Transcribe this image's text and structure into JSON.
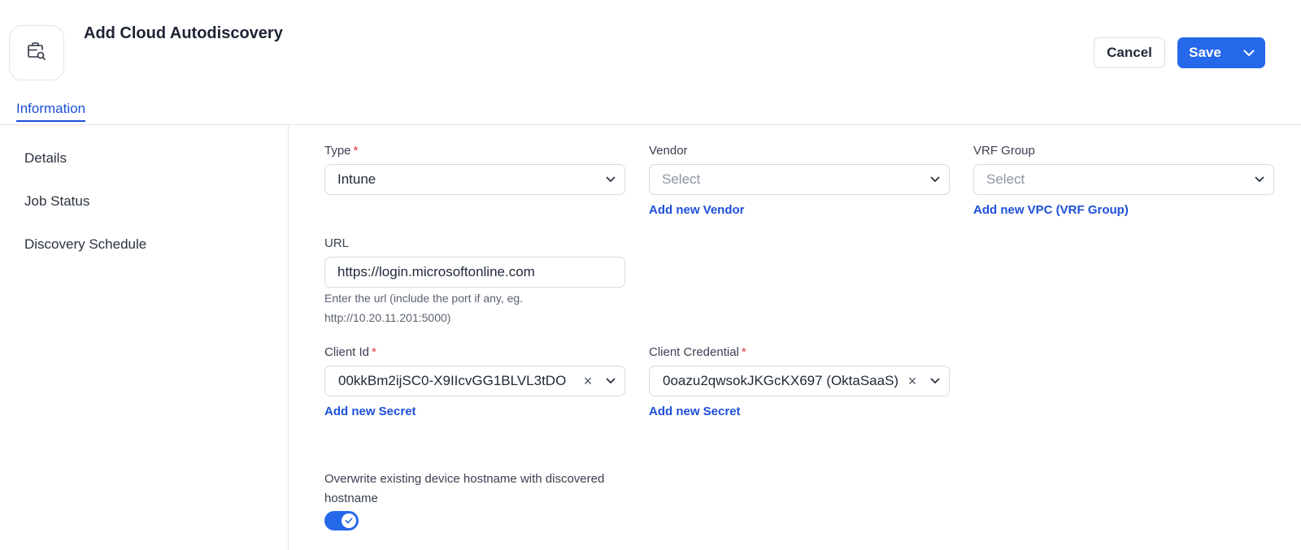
{
  "header": {
    "title": "Add Cloud Autodiscovery",
    "icon": "briefcase-search-icon",
    "cancel_label": "Cancel",
    "save_label": "Save"
  },
  "tabs": [
    {
      "label": "Information",
      "active": true
    }
  ],
  "sidebar": {
    "items": [
      {
        "label": "Details"
      },
      {
        "label": "Job Status"
      },
      {
        "label": "Discovery Schedule"
      }
    ]
  },
  "form": {
    "type": {
      "label": "Type",
      "required": "*",
      "value": "Intune"
    },
    "vendor": {
      "label": "Vendor",
      "placeholder": "Select",
      "add_link": "Add new Vendor"
    },
    "vrf_group": {
      "label": "VRF Group",
      "placeholder": "Select",
      "add_link": "Add new VPC (VRF Group)"
    },
    "url": {
      "label": "URL",
      "value": "https://login.microsoftonline.com",
      "hint_line1": "Enter the url (include the port if any, eg.",
      "hint_line2": "http://10.20.11.201:5000)"
    },
    "client_id": {
      "label": "Client Id",
      "required": "*",
      "value": "00kkBm2ijSC0-X9IIcvGG1BLVL3tDO",
      "add_link": "Add new Secret"
    },
    "client_credential": {
      "label": "Client Credential",
      "required": "*",
      "value": "0oazu2qwsokJKGcKX697 (OktaSaaS)",
      "add_link": "Add new Secret"
    },
    "overwrite_hostname": {
      "label_line1": "Overwrite existing device hostname with discovered",
      "label_line2": "hostname",
      "enabled": true
    }
  },
  "colors": {
    "accent": "#2668ea",
    "link": "#1d4fd8",
    "required": "#e0363a"
  }
}
